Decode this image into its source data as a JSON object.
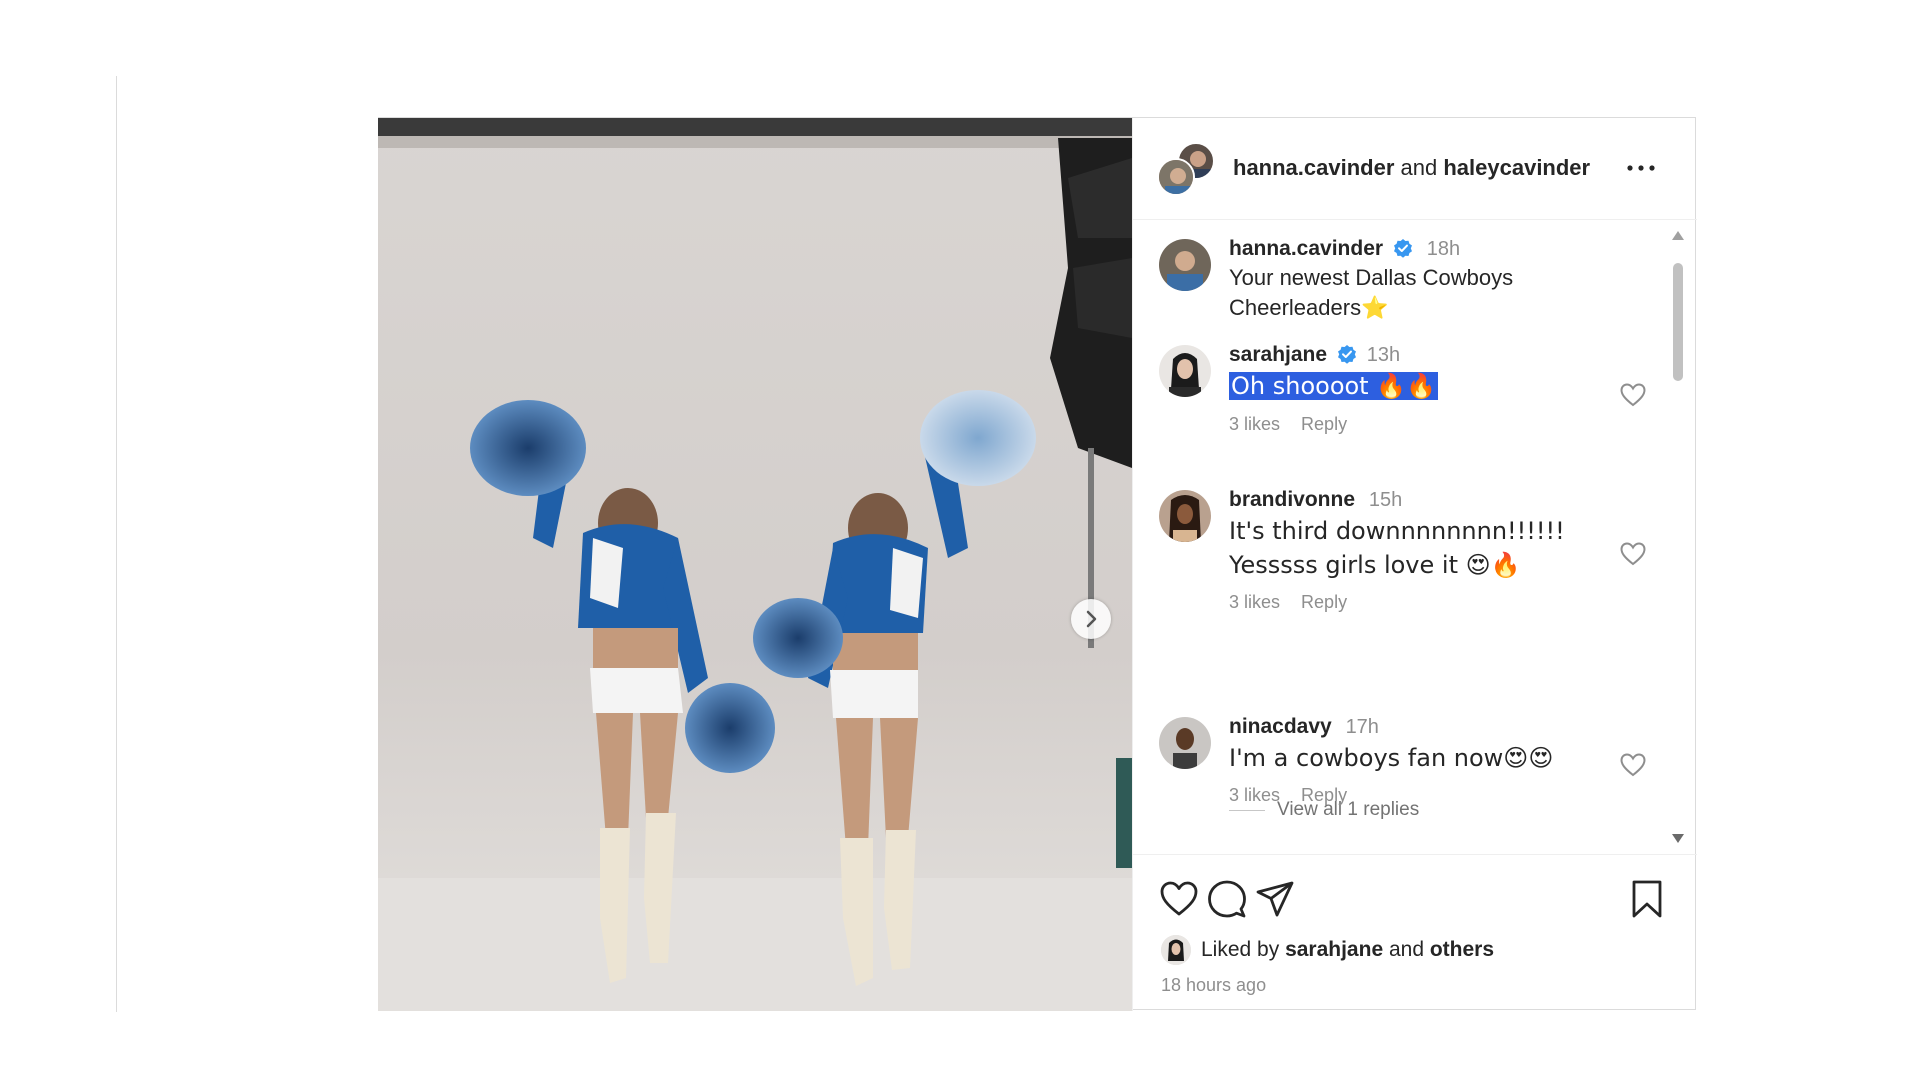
{
  "post": {
    "header": {
      "user1": "hanna.cavinder",
      "joiner": "and",
      "user2": "haleycavinder"
    },
    "caption": {
      "user": "hanna.cavinder",
      "time": "18h",
      "text": "Your newest Dallas Cowboys Cheerleaders⭐"
    },
    "comments": [
      {
        "user": "sarahjane",
        "verified": true,
        "time": "13h",
        "text": "Oh shoooot 🔥🔥",
        "likes": "3 likes",
        "reply": "Reply"
      },
      {
        "user": "brandivonne",
        "verified": false,
        "time": "15h",
        "text_line1": "It's third downnnnnnnn!!!!!!",
        "text_line2": "Yesssss girls love it 😍🔥",
        "likes": "3 likes",
        "reply": "Reply",
        "view_replies": "View all 1 replies"
      },
      {
        "user": "ninacdavy",
        "verified": false,
        "time": "17h",
        "text": "I'm a cowboys fan now😍😍",
        "likes": "3 likes",
        "reply": "Reply"
      }
    ],
    "footer": {
      "liked_prefix": "Liked by",
      "liked_user": "sarahjane",
      "liked_and": "and",
      "liked_others": "others",
      "timestamp": "18 hours ago"
    },
    "icons": {
      "more": "more-options-icon",
      "next": "chevron-right-icon",
      "like": "heart-icon",
      "comment": "comment-bubble-icon",
      "share": "paper-plane-icon",
      "save": "bookmark-icon",
      "verified": "verified-badge-icon"
    },
    "colors": {
      "verified": "#3897f0",
      "selection": "#2d5fe0",
      "uniform_blue": "#1f5fa8"
    }
  }
}
